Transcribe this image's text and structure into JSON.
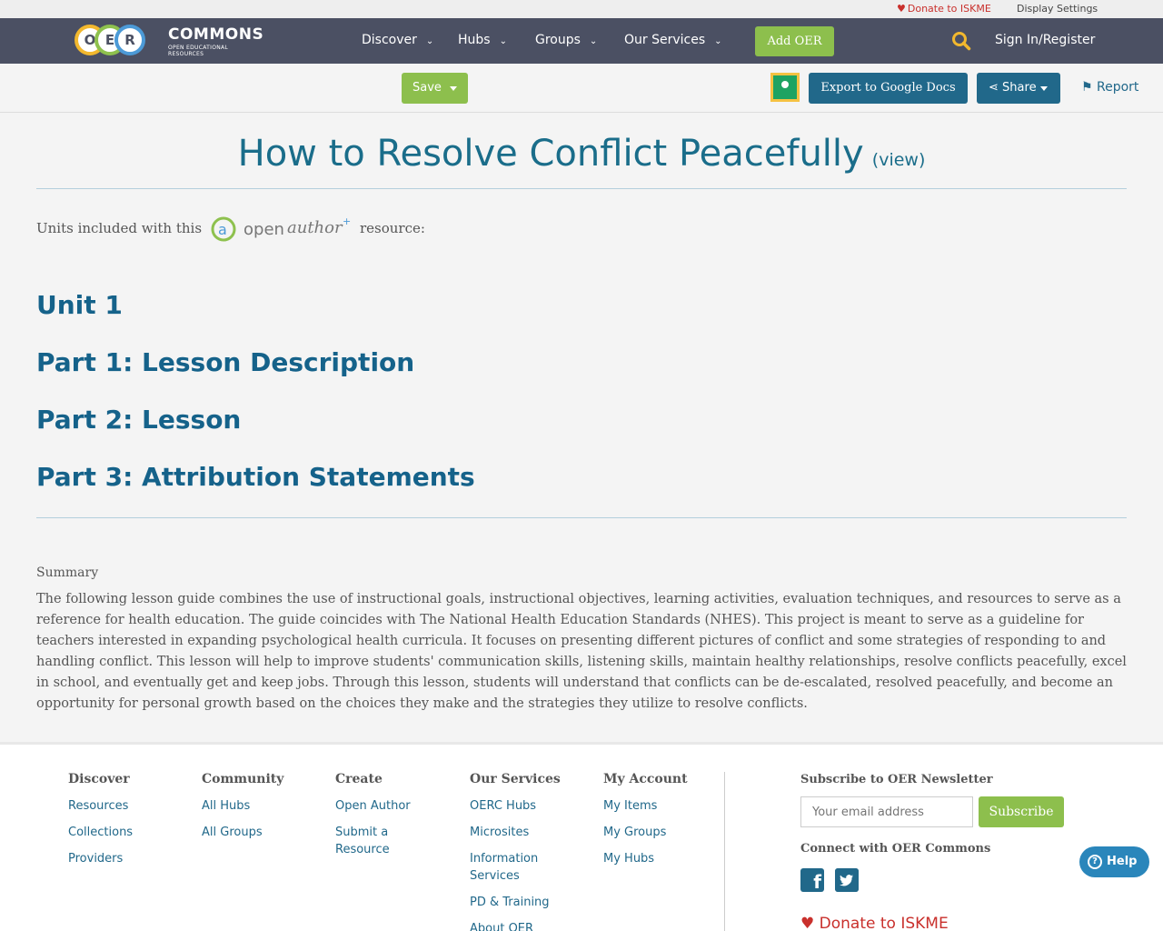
{
  "util": {
    "donate": "Donate to ISKME",
    "display_settings": "Display Settings"
  },
  "nav": {
    "logo_letters": [
      "O",
      "E",
      "R"
    ],
    "logo_word": "COMMONS",
    "logo_tag": "OPEN EDUCATIONAL RESOURCES",
    "items": [
      {
        "label": "Discover"
      },
      {
        "label": "Hubs"
      },
      {
        "label": "Groups"
      },
      {
        "label": "Our Services"
      }
    ],
    "add_oer": "Add OER",
    "signin": "Sign In/Register"
  },
  "toolbar": {
    "save": "Save",
    "export": "Export to Google Docs",
    "share": "Share",
    "report": "Report"
  },
  "page": {
    "title": "How to Resolve Conflict Peacefully",
    "view": "(view)",
    "units_label": "Units included with this",
    "resource_label": "resource:",
    "units": [
      {
        "label": "Unit 1"
      },
      {
        "label": "Part 1: Lesson Description"
      },
      {
        "label": "Part 2: Lesson"
      },
      {
        "label": "Part 3: Attribution Statements"
      }
    ],
    "summary_label": "Summary",
    "summary": "The following lesson guide combines the use of instructional goals, instructional objectives, learning activities, evaluation techniques, and resources to serve as a reference for health education. The guide coincides with The National Health Education Standards (NHES). This project is meant to serve as a guideline for teachers interested in expanding psychological health curricula. It focuses on presenting different pictures of conflict and some strategies of responding to and handling conflict. This lesson will help to improve students' communication skills, listening skills, maintain healthy relationships, resolve conflicts peacefully, excel in school, and eventually get and keep jobs. Through this lesson, students will understand that conflicts can be de-escalated, resolved peacefully, and become an opportunity for personal growth based on the choices they make and the strategies they utilize to resolve conflicts."
  },
  "footer": {
    "columns": [
      {
        "title": "Discover",
        "links": [
          "Resources",
          "Collections",
          "Providers"
        ]
      },
      {
        "title": "Community",
        "links": [
          "All Hubs",
          "All Groups"
        ]
      },
      {
        "title": "Create",
        "links": [
          "Open Author",
          "Submit a Resource"
        ]
      },
      {
        "title": "Our Services",
        "links": [
          "OERC Hubs",
          "Microsites",
          "Information Services",
          "PD & Training",
          "About OER"
        ]
      },
      {
        "title": "My Account",
        "links": [
          "My Items",
          "My Groups",
          "My Hubs"
        ]
      }
    ],
    "subscribe_title": "Subscribe to OER Newsletter",
    "email_placeholder": "Your email address",
    "subscribe_btn": "Subscribe",
    "connect_title": "Connect with OER Commons",
    "donate": "Donate to ISKME",
    "help": "Help"
  },
  "colors": {
    "nav_bg": "#4b5063",
    "green": "#8dbf4d",
    "blue": "#21688a",
    "heading": "#15628a",
    "donate_red": "#c9302c"
  }
}
